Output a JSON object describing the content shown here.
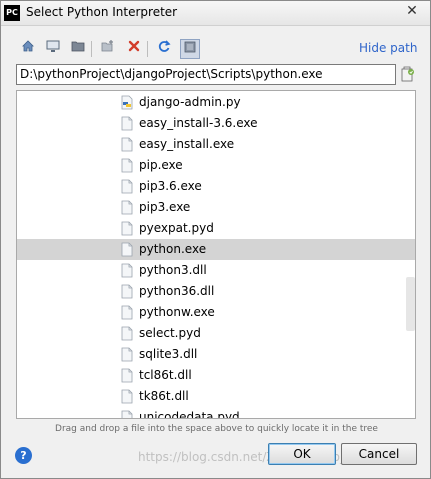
{
  "window": {
    "title": "Select Python Interpreter",
    "app_icon_text": "PC",
    "close_glyph": "✕"
  },
  "toolbar": {
    "buttons": [
      {
        "icon": "home-icon"
      },
      {
        "icon": "desktop-icon"
      },
      {
        "icon": "project-folder-icon"
      },
      {
        "icon": "new-folder-icon"
      },
      {
        "icon": "delete-icon",
        "color": "#d23c2a"
      },
      {
        "icon": "refresh-icon",
        "color": "#2a6fd0"
      },
      {
        "icon": "show-hidden-icon"
      }
    ],
    "hide_path_label": "Hide path"
  },
  "path": {
    "value": "D:\\pythonProject\\djangoProject\\Scripts\\python.exe"
  },
  "tree": {
    "items": [
      {
        "label": "django-admin.py",
        "icon": "python-file-icon"
      },
      {
        "label": "easy_install-3.6.exe",
        "icon": "file-icon"
      },
      {
        "label": "easy_install.exe",
        "icon": "file-icon"
      },
      {
        "label": "pip.exe",
        "icon": "file-icon"
      },
      {
        "label": "pip3.6.exe",
        "icon": "file-icon"
      },
      {
        "label": "pip3.exe",
        "icon": "file-icon"
      },
      {
        "label": "pyexpat.pyd",
        "icon": "file-icon"
      },
      {
        "label": "python.exe",
        "icon": "file-icon",
        "selected": true
      },
      {
        "label": "python3.dll",
        "icon": "file-icon"
      },
      {
        "label": "python36.dll",
        "icon": "file-icon"
      },
      {
        "label": "pythonw.exe",
        "icon": "file-icon"
      },
      {
        "label": "select.pyd",
        "icon": "file-icon"
      },
      {
        "label": "sqlite3.dll",
        "icon": "file-icon"
      },
      {
        "label": "tcl86t.dll",
        "icon": "file-icon"
      },
      {
        "label": "tk86t.dll",
        "icon": "file-icon"
      },
      {
        "label": "unicodedata.pyd",
        "icon": "file-icon"
      }
    ]
  },
  "hint": "Drag and drop a file into the space above to quickly locate it in the tree",
  "buttons": {
    "help_glyph": "?",
    "ok": "OK",
    "cancel": "Cancel"
  },
  "watermark": "https://blog.csdn.net/Zhang_Jinao_1993",
  "colors": {
    "accent": "#2f65ca",
    "selection": "#d4d4d4"
  }
}
